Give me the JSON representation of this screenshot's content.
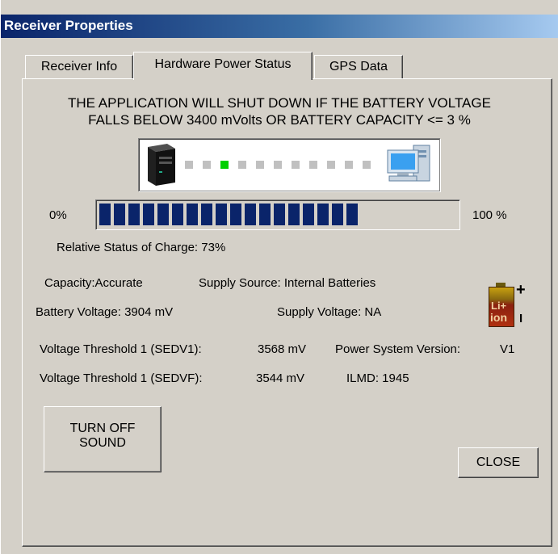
{
  "window": {
    "title": "Receiver Properties"
  },
  "tabs": [
    {
      "label": "Receiver Info",
      "active": false
    },
    {
      "label": "Hardware Power Status",
      "active": true
    },
    {
      "label": "GPS Data",
      "active": false
    }
  ],
  "warning": {
    "line1": "THE APPLICATION WILL SHUT DOWN IF THE BATTERY VOLTAGE",
    "line2": "FALLS BELOW 3400 mVolts OR BATTERY CAPACITY <= 3 %"
  },
  "connection": {
    "left_icon": "tower-pc-icon",
    "right_icon": "desktop-computer-icon",
    "dot_count": 11,
    "active_dot": 2
  },
  "charge": {
    "min_label": "0%",
    "max_label": "100 %",
    "progress_fraction": 0.73,
    "status_label": "Relative Status of Charge: 73%"
  },
  "details": {
    "capacity": "Capacity:Accurate",
    "supply_source": "Supply Source: Internal Batteries",
    "battery_voltage": "Battery Voltage: 3904 mV",
    "supply_voltage": "Supply Voltage: NA",
    "sedv1_label": "Voltage Threshold 1 (SEDV1):",
    "sedv1_value": "3568 mV",
    "power_system_label": "Power System Version:",
    "power_system_value": "V1",
    "sedvf_label": "Voltage Threshold 1 (SEDVF):",
    "sedvf_value": "3544 mV",
    "ilmd": "ILMD: 1945"
  },
  "battery_icon": {
    "line1": "Li+",
    "line2": "ion",
    "plus": "+",
    "minus": "I"
  },
  "buttons": {
    "sound_line1": "TURN OFF",
    "sound_line2": "SOUND",
    "close": "CLOSE"
  }
}
